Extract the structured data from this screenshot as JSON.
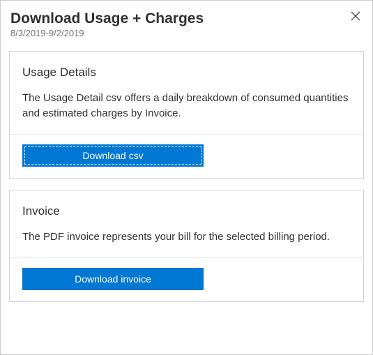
{
  "header": {
    "title": "Download Usage + Charges",
    "date_range": "8/3/2019-9/2/2019"
  },
  "usage_details": {
    "title": "Usage Details",
    "description": "The Usage Detail csv offers a daily breakdown of consumed quantities and estimated charges by Invoice.",
    "button_label": "Download csv"
  },
  "invoice": {
    "title": "Invoice",
    "description": "The PDF invoice represents your bill for the selected billing period.",
    "button_label": "Download invoice"
  },
  "colors": {
    "primary": "#0078d4"
  }
}
